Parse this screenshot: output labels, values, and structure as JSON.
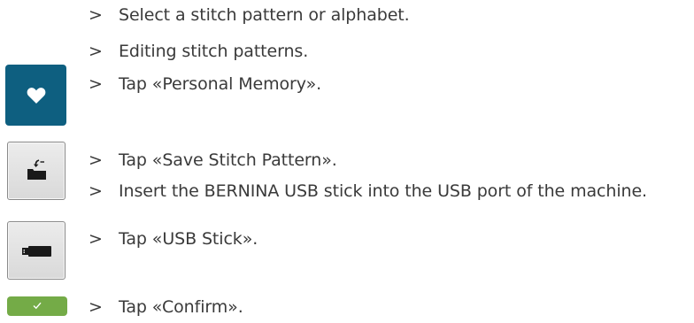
{
  "arrow_glyph": ">",
  "steps": [
    {
      "text": "Select a stitch pattern or alphabet."
    },
    {
      "text": "Editing stitch patterns."
    },
    {
      "text": "Tap «Personal Memory»."
    },
    {
      "text": "Tap «Save Stitch Pattern»."
    },
    {
      "text": "Insert the BERNINA USB stick into the USB port of the machine."
    },
    {
      "text": "Tap «USB Stick»."
    },
    {
      "text": "Tap «Confirm»."
    }
  ],
  "buttons": {
    "personal_memory": {
      "icon": "heart-icon",
      "color": "#0e5f80"
    },
    "save_stitch_pattern": {
      "icon": "folder-save-icon",
      "color": "#e0e0e0"
    },
    "usb_stick": {
      "icon": "usb-stick-icon",
      "color": "#e0e0e0"
    },
    "confirm": {
      "icon": "checkmark-icon",
      "color": "#74ab47"
    }
  }
}
